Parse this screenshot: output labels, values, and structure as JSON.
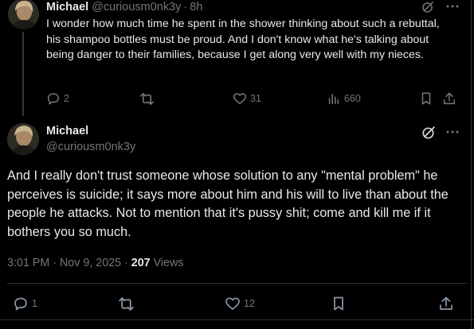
{
  "reply": {
    "author": "Michael",
    "handle": "@curiousm0nk3y",
    "separator": "·",
    "time": "8h",
    "text": "I wonder how much time he spent in the shower thinking about such a rebuttal, his shampoo bottles must be proud. And I don't know what he's talking about being danger to their families, because I get along very well with my nieces.",
    "stats": {
      "replies": "2",
      "likes": "31",
      "views": "660"
    }
  },
  "tweet": {
    "author": "Michael",
    "handle": "@curiousm0nk3y",
    "text": "And I really don't trust someone whose solution to any \"mental problem\" he perceives is suicide; it says more about him and his will to live than about the people he attacks. Not to mention that it's pussy shit; come and kill me if it bothers you so much.",
    "timestamp": "3:01 PM · Nov 9, 2025 · ",
    "views_count": "207",
    "views_label": " Views",
    "stats": {
      "replies": "1",
      "likes": "12"
    }
  },
  "icons": [
    "avatar",
    "grok-icon",
    "more-icon",
    "reply-icon",
    "retweet-icon",
    "like-icon",
    "views-icon",
    "bookmark-icon",
    "share-icon"
  ],
  "colors": {
    "background": "#000000",
    "text": "#e7e9ea",
    "muted": "#71767b",
    "divider": "#2f3336"
  }
}
